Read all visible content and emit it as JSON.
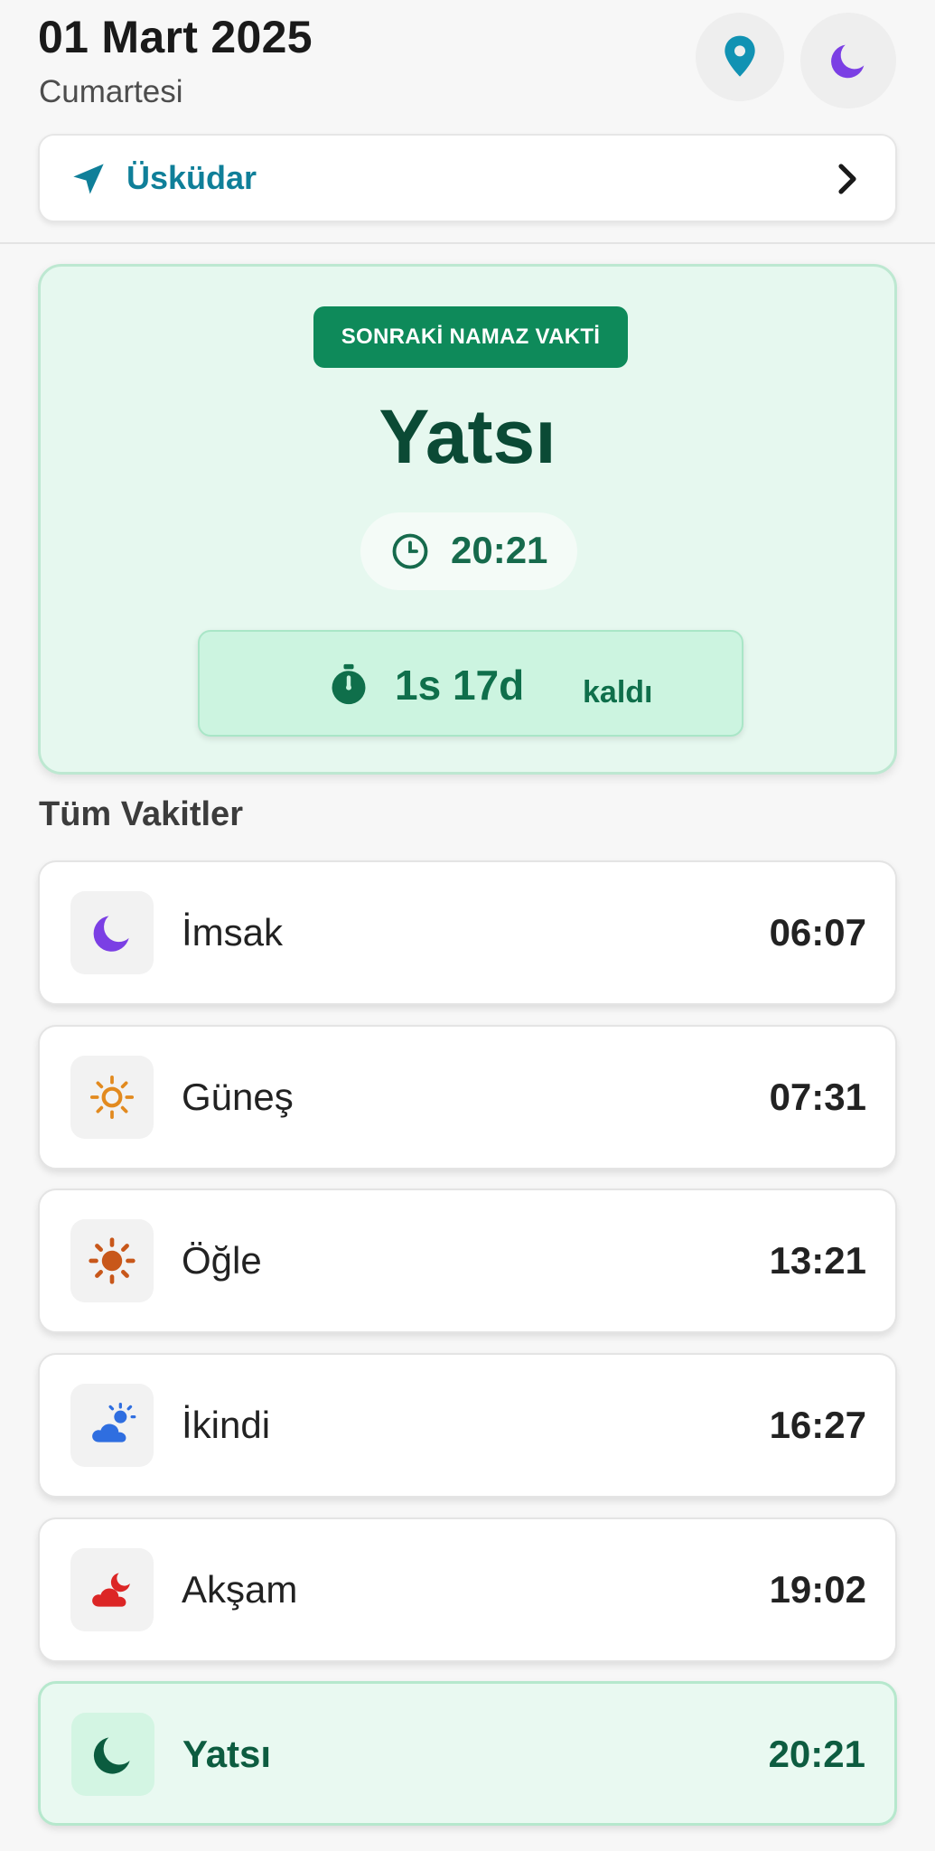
{
  "header": {
    "date": "01 Mart 2025",
    "day": "Cumartesi",
    "location_icon": "map-pin-icon",
    "theme_icon": "moon-icon"
  },
  "location": {
    "name": "Üsküdar",
    "icon": "navigation-arrow-icon",
    "chevron": "chevron-right-icon"
  },
  "next_prayer": {
    "badge": "SONRAKİ NAMAZ VAKTİ",
    "name": "Yatsı",
    "time": "20:21",
    "remaining": "1s 17d",
    "remaining_suffix": "kaldı"
  },
  "section_title": "Tüm Vakitler",
  "prayers": [
    {
      "name": "İmsak",
      "time": "06:07",
      "icon": "moon-icon"
    },
    {
      "name": "Güneş",
      "time": "07:31",
      "icon": "sunrise-icon"
    },
    {
      "name": "Öğle",
      "time": "13:21",
      "icon": "sun-icon"
    },
    {
      "name": "İkindi",
      "time": "16:27",
      "icon": "cloud-sun-icon"
    },
    {
      "name": "Akşam",
      "time": "19:02",
      "icon": "cloud-moon-icon"
    },
    {
      "name": "Yatsı",
      "time": "20:21",
      "icon": "crescent-moon-icon",
      "active": true
    }
  ],
  "colors": {
    "accent_green": "#0e8a5a",
    "dark_green": "#0b4a35",
    "location_blue": "#0f7f99",
    "moon_purple": "#7b3fe4",
    "sun_orange": "#e28a1f",
    "sun_dark_orange": "#c8571a",
    "cloud_blue": "#2f6ee0",
    "sunset_red": "#dc2626"
  }
}
